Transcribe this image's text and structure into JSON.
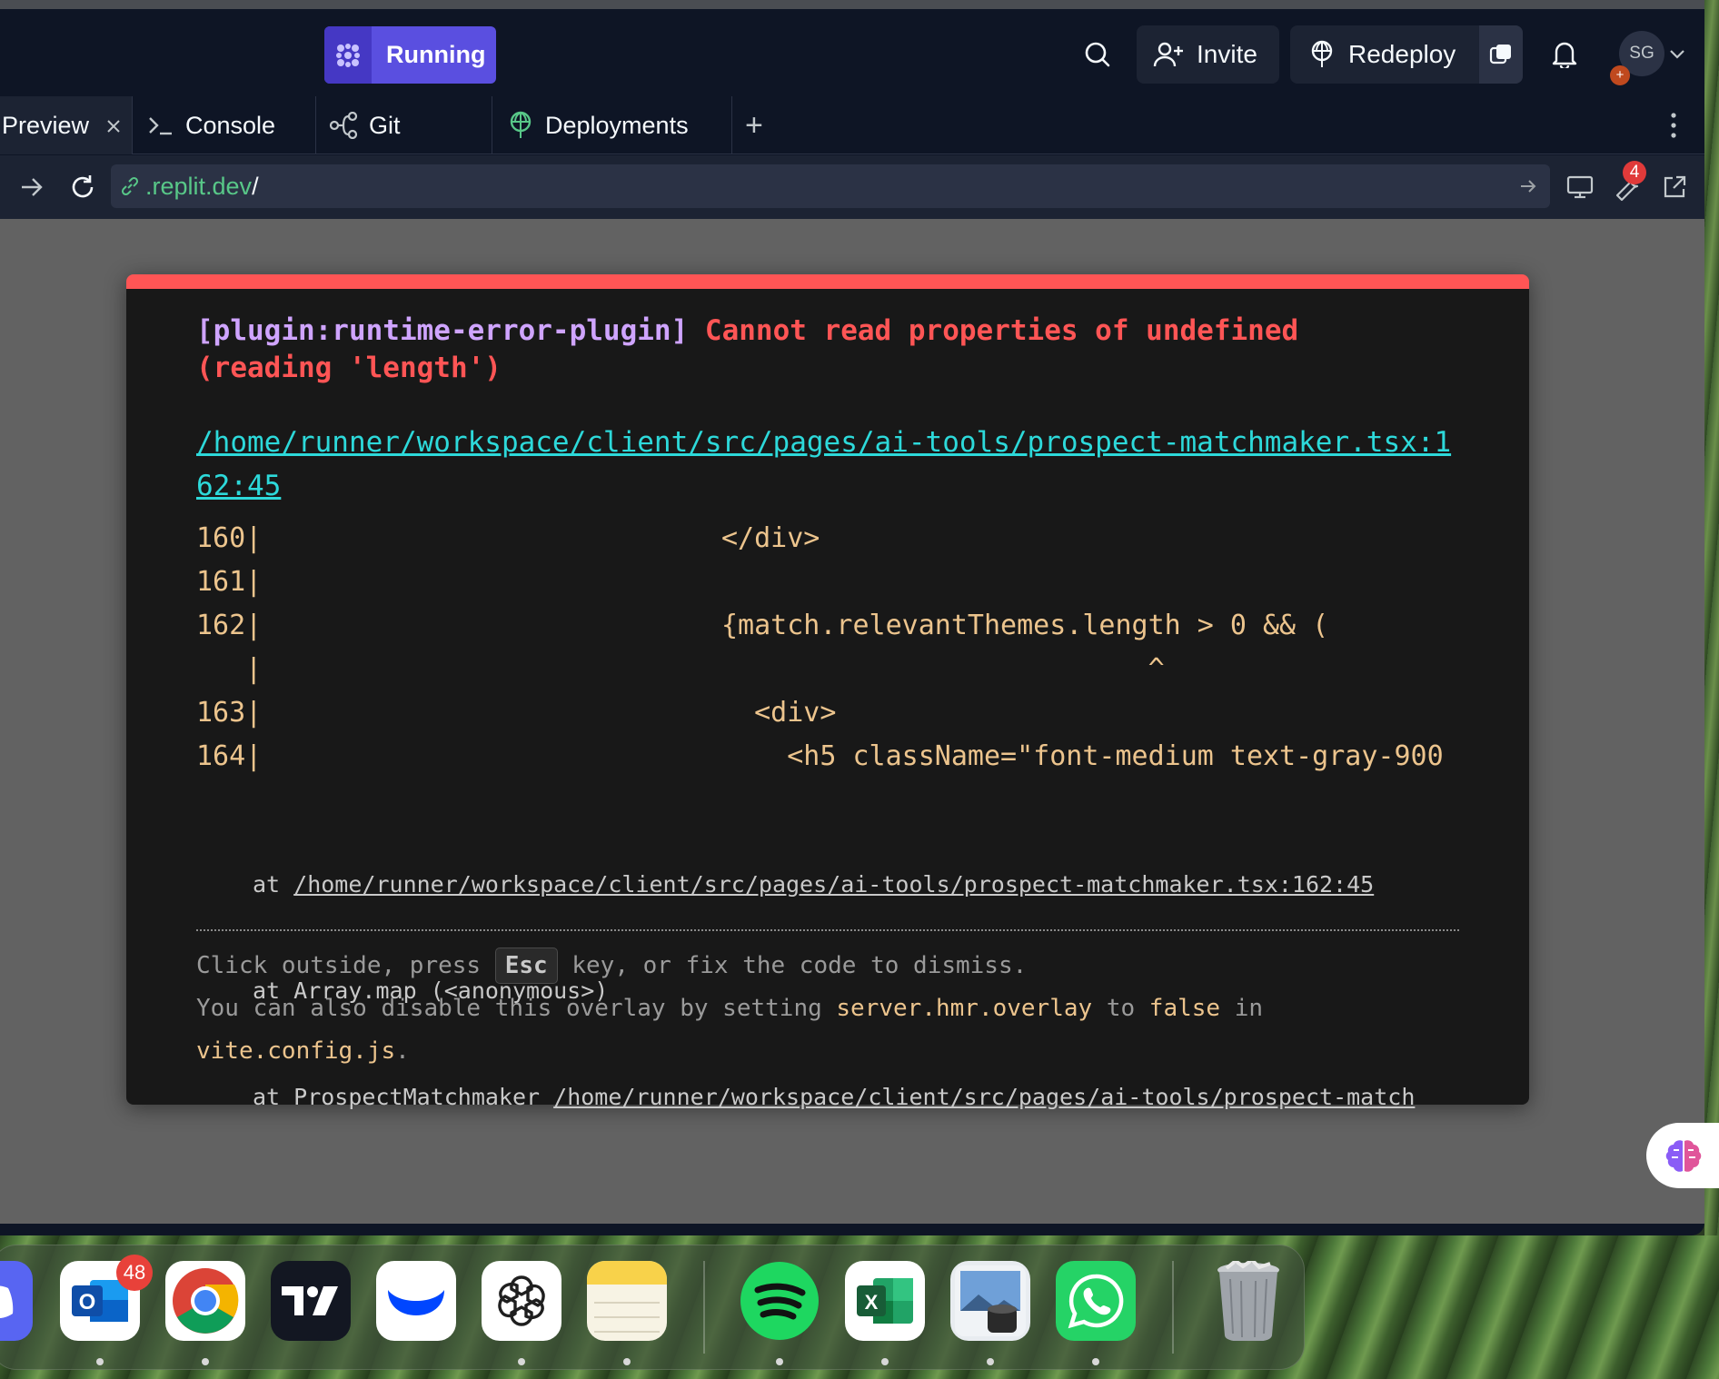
{
  "header": {
    "run_label": "Running",
    "invite_label": "Invite",
    "redeploy_label": "Redeploy",
    "avatar_initials": "SG",
    "avatar_badge": "+"
  },
  "tabs": {
    "preview": "Preview",
    "console": "Console",
    "git": "Git",
    "deployments": "Deployments",
    "add": "+"
  },
  "urlbar": {
    "url_domain": ".replit.dev",
    "url_path": "/",
    "devtools_badge": "4"
  },
  "error_overlay": {
    "plugin": "[plugin:runtime-error-plugin]",
    "message": "Cannot read properties of undefined (reading 'length')",
    "file_link": "/home/runner/workspace/client/src/pages/ai-tools/prospect-matchmaker.tsx:162:45",
    "code_frame": "160|                            </div>\n161|\n162|                            {match.relevantThemes.length > 0 && (\n   |                                                      ^\n163|                              <div>\n164|                                <h5 className=\"font-medium text-gray-900",
    "stack": [
      {
        "prefix": "at ",
        "link": "/home/runner/workspace/client/src/pages/ai-tools/prospect-matchmaker.tsx:162:45"
      },
      {
        "prefix": "at Array.map (<anonymous>)",
        "link": ""
      },
      {
        "prefix": "at ProspectMatchmaker ",
        "link": "/home/runner/workspace/client/src/pages/ai-tools/prospect-match"
      }
    ],
    "tip_part1": "Click outside, press ",
    "tip_key": "Esc",
    "tip_part2": " key, or fix the code to dismiss.",
    "tip_line2_a": "You can also disable this overlay by setting ",
    "tip_line2_code1": "server.hmr.overlay",
    "tip_line2_b": " to ",
    "tip_line2_code2": "false",
    "tip_line2_c": " in",
    "tip_line3_code": "vite.config.js",
    "tip_line3_end": "."
  },
  "dock": {
    "outlook_badge": "48",
    "excel_letter": "X",
    "outlook_letter": "O"
  }
}
